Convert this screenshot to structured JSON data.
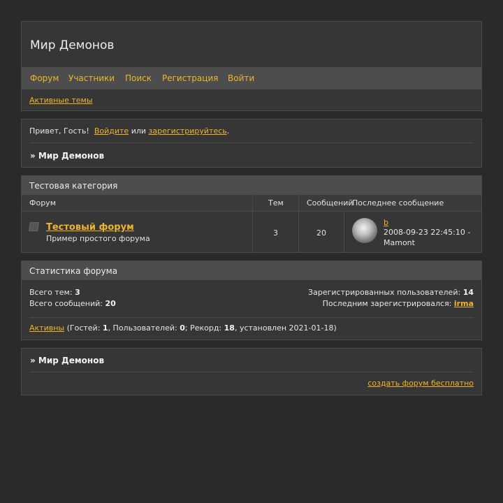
{
  "site": {
    "title": "Мир Демонов",
    "nav": [
      "Форум",
      "Участники",
      "Поиск",
      "Регистрация",
      "Войти"
    ],
    "active_topics": "Активные темы"
  },
  "welcome": {
    "greeting": "Привет, Гость!",
    "login": "Войдите",
    "or": "или",
    "register": "зарегистрируйтесь",
    "dot": ".",
    "crumb": "» Мир Демонов"
  },
  "category": {
    "title": "Тестовая категория",
    "columns": {
      "forum": "Форум",
      "topics": "Тем",
      "posts": "Сообщений",
      "last": "Последнее сообщение"
    },
    "forum": {
      "name": "Тестовый форум",
      "description": "Пример простого форума",
      "topics": "3",
      "posts": "20",
      "last_post_link": "b",
      "last_post_time": "2008-09-23 22:45:10 - Mamont"
    }
  },
  "stats": {
    "title": "Статистика форума",
    "total_topics_label": "Всего тем:",
    "total_topics": "3",
    "total_posts_label": "Всего сообщений:",
    "total_posts": "20",
    "registered_label": "Зарегистрированных пользователей:",
    "registered": "14",
    "last_registered_label": "Последним зарегистрировался:",
    "last_registered": "irma",
    "online_link": "Активны",
    "online_open": " (Гостей: ",
    "guests": "1",
    "users_label": ", Пользователей: ",
    "users": "0",
    "record_label": "; Рекорд: ",
    "record": "18",
    "record_date": ", установлен 2021-01-18)"
  },
  "footer": {
    "crumb": "» Мир Демонов",
    "create_forum": "создать форум бесплатно"
  },
  "colors": {
    "accent": "#f0b429",
    "background": "#2a2a2a",
    "panel": "#363636",
    "bar": "#4d4d4d"
  },
  "icons": {
    "forum_status": "forum-status-icon",
    "avatar": "user-avatar"
  }
}
